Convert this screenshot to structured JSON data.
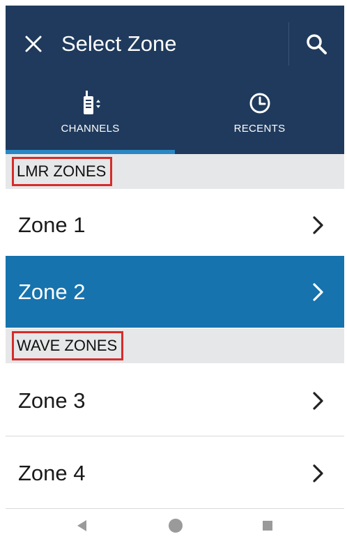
{
  "header": {
    "title": "Select Zone",
    "close_icon": "close-icon",
    "search_icon": "search-icon"
  },
  "tabs": [
    {
      "label": "CHANNELS",
      "icon": "radio-icon",
      "selected": true
    },
    {
      "label": "RECENTS",
      "icon": "clock-icon",
      "selected": false
    }
  ],
  "sections": [
    {
      "title": "LMR ZONES",
      "items": [
        {
          "label": "Zone 1",
          "selected": false
        },
        {
          "label": "Zone 2",
          "selected": true
        }
      ]
    },
    {
      "title": "WAVE ZONES",
      "items": [
        {
          "label": "Zone 3",
          "selected": false
        },
        {
          "label": "Zone 4",
          "selected": false
        }
      ]
    }
  ],
  "navbar": {
    "back_icon": "back-triangle-icon",
    "home_icon": "home-circle-icon",
    "recents_icon": "recents-square-icon"
  },
  "colors": {
    "appbar": "#1f3a5c",
    "tab_indicator": "#2a87c4",
    "selected_row": "#1673ad",
    "section_header_bg": "#e6e7e8",
    "highlight_box": "#d62c2c"
  }
}
